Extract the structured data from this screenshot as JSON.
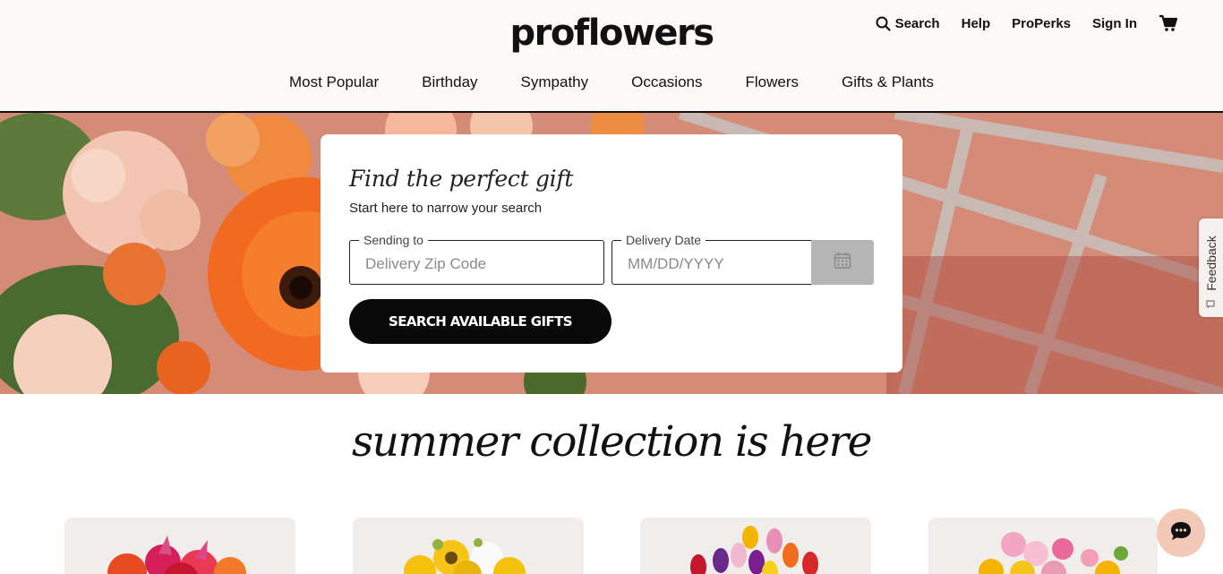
{
  "brand": {
    "logo": "proflowers"
  },
  "utility_nav": {
    "search": "Search",
    "help": "Help",
    "properks": "ProPerks",
    "signin": "Sign In"
  },
  "nav": [
    "Most Popular",
    "Birthday",
    "Sympathy",
    "Occasions",
    "Flowers",
    "Gifts & Plants"
  ],
  "finder": {
    "heading": "Find the perfect gift",
    "subheading": "Start here to narrow your search",
    "zip_legend": "Sending to",
    "zip_placeholder": "Delivery Zip Code",
    "date_legend": "Delivery Date",
    "date_placeholder": "MM/DD/YYYY",
    "button": "SEARCH AVAILABLE GIFTS"
  },
  "feedback": {
    "label": "Feedback"
  },
  "collection": {
    "title": "summer collection is here"
  },
  "colors": {
    "header_bg": "#fdf9f6",
    "button": "#0a0a0a",
    "chat": "#f3c8b6"
  },
  "icons": [
    "search-icon",
    "cart-icon",
    "calendar-icon",
    "chat-icon",
    "feedback-icon"
  ]
}
